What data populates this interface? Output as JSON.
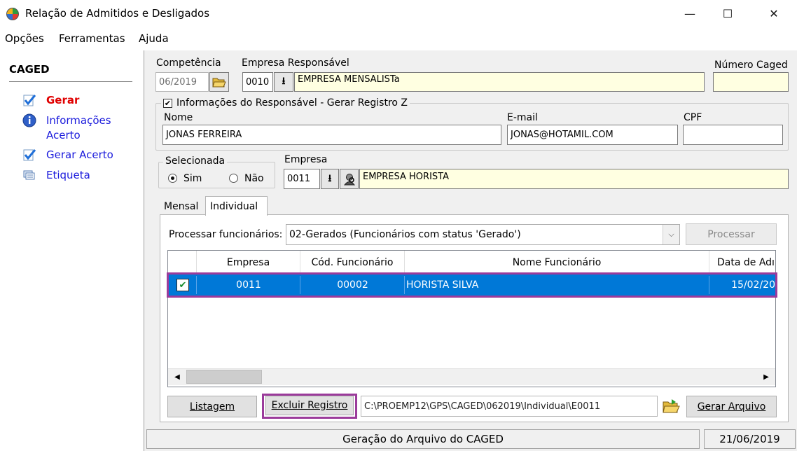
{
  "window": {
    "title": "Relação de Admitidos e Desligados",
    "controls": {
      "minimize": "—",
      "maximize": "☐",
      "close": "✕"
    }
  },
  "menu": {
    "items": [
      "Opções",
      "Ferramentas",
      "Ajuda"
    ]
  },
  "sidebar": {
    "title": "CAGED",
    "items": [
      {
        "icon": "check-document-icon",
        "label": "Gerar",
        "color": "#e00000"
      },
      {
        "icon": "info-icon",
        "label_line1": "Informações",
        "label_line2": "Acerto",
        "color": "#1a1adc"
      },
      {
        "icon": "check-document-icon",
        "label": "Gerar Acerto",
        "color": "#1a1adc"
      },
      {
        "icon": "label-icon",
        "label": "Etiqueta",
        "color": "#1a1adc"
      }
    ]
  },
  "form": {
    "competencia_label": "Competência",
    "competencia_value": "06/2019",
    "empresa_resp_label": "Empresa Responsável",
    "empresa_resp_code": "0010",
    "empresa_resp_name": "EMPRESA MENSALISTa",
    "numero_caged_label": "Número Caged",
    "numero_caged_value": "",
    "responsavel_group": "Informações do Responsável - Gerar Registro Z",
    "responsavel_checked": true,
    "nome_label": "Nome",
    "nome_value": "JONAS FERREIRA",
    "email_label": "E-mail",
    "email_value": "JONAS@HOTAMIL.COM",
    "cpf_label": "CPF",
    "cpf_value": "",
    "selecionada_group": "Selecionada",
    "radio_sim": "Sim",
    "radio_nao": "Não",
    "selected_radio": "Sim",
    "empresa_label": "Empresa",
    "empresa_code": "0011",
    "empresa_name": "EMPRESA HORISTA"
  },
  "tabs": [
    {
      "label": "Mensal",
      "active": false
    },
    {
      "label": "Individual",
      "active": true
    }
  ],
  "individual": {
    "processar_label": "Processar funcionários:",
    "processar_value": "02-Gerados (Funcionários com status 'Gerado')",
    "processar_button": "Processar",
    "columns": [
      "Empresa",
      "Cód. Funcionário",
      "Nome Funcionário",
      "Data de Adı"
    ],
    "rows": [
      {
        "checked": true,
        "empresa": "0011",
        "codigo": "00002",
        "nome": "HORISTA SILVA",
        "data": "15/02/20"
      }
    ],
    "listagem_button": "Listagem",
    "excluir_button": "Excluir Registro",
    "path_value": "C:\\PROEMP12\\GPS\\CAGED\\062019\\Individual\\E0011",
    "gerar_button": "Gerar Arquivo"
  },
  "status": {
    "message": "Geração do Arquivo do CAGED",
    "date": "21/06/2019"
  },
  "colors": {
    "selection": "#0078d7",
    "highlight_box": "#9b3b9b",
    "field_yellow": "#ffffe1"
  }
}
